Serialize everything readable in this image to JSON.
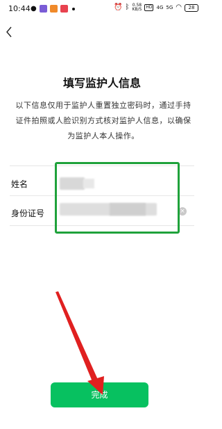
{
  "status_bar": {
    "time": "10:44",
    "net_speed_value": "0.58",
    "net_speed_unit": "KB/S",
    "hd_badge": "HD",
    "signal_4g": "4G",
    "signal_5g": "5G",
    "battery": "28"
  },
  "page": {
    "title": "填写监护人信息",
    "description": "以下信息仅用于监护人重置独立密码时，通过手持证件拍照或人脸识别方式核对监护人信息，以确保为监护人本人操作。"
  },
  "form": {
    "name_label": "姓名",
    "id_label": "身份证号"
  },
  "actions": {
    "done_label": "完成"
  },
  "colors": {
    "primary_green": "#07c160",
    "highlight_frame": "#1fa23b",
    "annotation_arrow": "#e02020"
  }
}
